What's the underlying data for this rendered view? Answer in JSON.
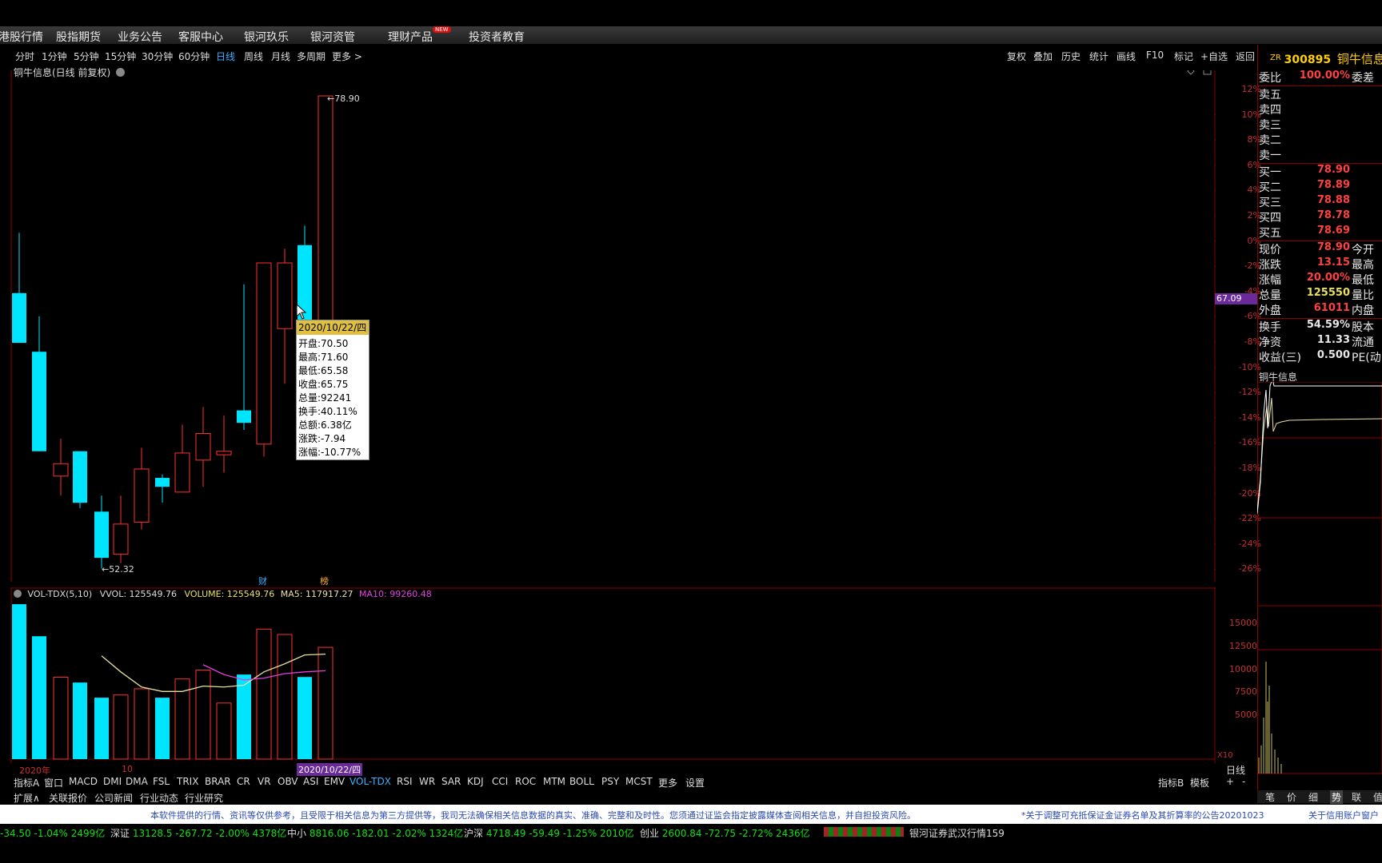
{
  "menu": [
    "港股行情",
    "股指期货",
    "业务公告",
    "客服中心",
    "银河玖乐",
    "银河资管",
    "理财产品",
    "投资者教育"
  ],
  "menu_badge": "NEW",
  "periods": [
    "分时",
    "1分钟",
    "5分钟",
    "15分钟",
    "30分钟",
    "60分钟",
    "日线",
    "周线",
    "月线",
    "多周期",
    "更多 >"
  ],
  "active_period": "日线",
  "tools": [
    "复权",
    "叠加",
    "历史",
    "统计",
    "画线",
    "F10",
    "标记",
    "+自选",
    "返回"
  ],
  "stock": {
    "prefix": "ZR",
    "code": "300895",
    "name": "铜牛信息"
  },
  "chart_title": "铜牛信息(日线 前复权)",
  "high_label": "78.90",
  "low_label": "52.32",
  "price_axis_label": "67.09",
  "markers": [
    "财",
    "榜"
  ],
  "tooltip": {
    "date": "2020/10/22/四",
    "rows": [
      "开盘:70.50",
      "最高:71.60",
      "最低:65.58",
      "收盘:65.75",
      "总量:92241",
      "换手:40.11%",
      "总额:6.38亿",
      "涨跌:-7.94",
      "涨幅:-10.77%"
    ]
  },
  "pct_ticks": [
    "12%",
    "10%",
    "8%",
    "6%",
    "4%",
    "2%",
    "0%",
    "-2%",
    "-4%",
    "-6%",
    "-8%",
    "-10%",
    "-12%",
    "-14%",
    "-16%",
    "-18%",
    "-20%",
    "-22%",
    "-24%",
    "-26%"
  ],
  "volume_header": {
    "name": "VOL-TDX(5,10)",
    "vvol": "VVOL: 125549.76",
    "volume": "VOLUME: 125549.76",
    "ma5": "MA5: 117917.27",
    "ma10": "MA10: 99260.48"
  },
  "volume_ticks": [
    "15000",
    "12500",
    "10000",
    "7500",
    "5000"
  ],
  "volume_unit": "X10",
  "axis_labels": {
    "year": "2020年",
    "month": "10",
    "date": "2020/10/22/四",
    "period": "日线"
  },
  "indicators": [
    "指标A",
    "窗口",
    "MACD",
    "DMI",
    "DMA",
    "FSL",
    "TRIX",
    "BRAR",
    "CR",
    "VR",
    "OBV",
    "ASI",
    "EMV",
    "VOL-TDX",
    "RSI",
    "WR",
    "SAR",
    "KDJ",
    "CCI",
    "ROC",
    "MTM",
    "BOLL",
    "PSY",
    "MCST",
    "更多",
    "设置"
  ],
  "active_indicator": "VOL-TDX",
  "right_tools": [
    "指标B",
    "模板",
    "+",
    "-"
  ],
  "bottom_tabs": [
    "扩展∧",
    "关联报价",
    "公司新闻",
    "行业动态",
    "行业研究"
  ],
  "quote": {
    "ratio_label": "委比",
    "ratio_value": "100.00%",
    "diff_label": "委差",
    "sell": [
      "卖五",
      "卖四",
      "卖三",
      "卖二",
      "卖一"
    ],
    "buy": [
      {
        "label": "买一",
        "value": "78.90"
      },
      {
        "label": "买二",
        "value": "78.89"
      },
      {
        "label": "买三",
        "value": "78.88"
      },
      {
        "label": "买四",
        "value": "78.78"
      },
      {
        "label": "买五",
        "value": "78.69"
      }
    ],
    "stats": [
      {
        "label": "现价",
        "value": "78.90",
        "label2": "今开"
      },
      {
        "label": "涨跌",
        "value": "13.15",
        "label2": "最高"
      },
      {
        "label": "涨幅",
        "value": "20.00%",
        "label2": "最低"
      },
      {
        "label": "总量",
        "value": "125550",
        "label2": "量比"
      },
      {
        "label": "外盘",
        "value": "61011",
        "label2": "内盘"
      },
      {
        "label": "换手",
        "value": "54.59%",
        "label2": "股本"
      },
      {
        "label": "净资",
        "value": "11.33",
        "label2": "流通"
      },
      {
        "label": "收益(三)",
        "value": "0.500",
        "label2": "PE(动"
      }
    ],
    "mini_title": "铜牛信息",
    "mini_tabs": [
      "笔",
      "价",
      "细",
      "势",
      "联",
      "值"
    ]
  },
  "disclaimer": "本软件提供的行情、资讯等仅供参考，且受限于相关信息为第三方提供等，我司无法确保相关信息数据的真实、准确、完整和及时性。您须通过证监会指定披露媒体查阅相关信息，并自担投资风险。",
  "notice1": "*关于调整可充抵保证金证券名单及其折算率的公告20201023",
  "notice2": "关于信用账户窗户",
  "ticker": [
    {
      "name": "",
      "text": "-34.50  -1.04%  2499亿"
    },
    {
      "name": "深证",
      "text": "13128.5  -267.72  -2.00%  4378亿"
    },
    {
      "name": "中小",
      "text": "8816.06  -182.01  -2.02%  1324亿"
    },
    {
      "name": "沪深",
      "text": "4718.49  -59.49  -1.25%  2010亿"
    },
    {
      "name": "创业",
      "text": "2600.84  -72.75  -2.72%  2436亿"
    }
  ],
  "status": "银河证券武汉行情159",
  "colors": {
    "up": "#ff3030",
    "down": "#00e5ff",
    "grid": "#8b0000",
    "ma5": "#e8e0a0",
    "ma10": "#e040e0"
  },
  "chart_data": [
    {
      "type": "candlestick",
      "title": "铜牛信息(日线 前复权)",
      "candles": [
        {
          "o": 67.8,
          "c": 65.0,
          "h": 71.2,
          "l": 65.0
        },
        {
          "o": 64.5,
          "c": 58.9,
          "h": 66.5,
          "l": 58.9
        },
        {
          "o": 57.5,
          "c": 58.2,
          "h": 59.6,
          "l": 56.4
        },
        {
          "o": 58.9,
          "c": 56.0,
          "h": 58.9,
          "l": 55.7
        },
        {
          "o": 55.5,
          "c": 52.9,
          "h": 56.4,
          "l": 52.3
        },
        {
          "o": 53.1,
          "c": 54.8,
          "h": 56.4,
          "l": 52.6
        },
        {
          "o": 54.9,
          "c": 57.9,
          "h": 59.1,
          "l": 54.5
        },
        {
          "o": 57.4,
          "c": 56.9,
          "h": 57.6,
          "l": 56.0
        },
        {
          "o": 56.6,
          "c": 58.8,
          "h": 60.4,
          "l": 56.6
        },
        {
          "o": 58.4,
          "c": 59.9,
          "h": 61.4,
          "l": 56.9
        },
        {
          "o": 58.7,
          "c": 58.9,
          "h": 60.9,
          "l": 57.7
        },
        {
          "o": 61.2,
          "c": 60.5,
          "h": 68.3,
          "l": 60.1
        },
        {
          "o": 59.3,
          "c": 69.5,
          "h": 69.5,
          "l": 58.6
        },
        {
          "o": 65.8,
          "c": 69.5,
          "h": 70.3,
          "l": 62.7
        },
        {
          "o": 70.5,
          "c": 65.75,
          "h": 71.6,
          "l": 65.58
        },
        {
          "o": 65.75,
          "c": 78.9,
          "h": 78.9,
          "l": 65.75
        }
      ],
      "ylim": [
        50,
        80
      ]
    },
    {
      "type": "bar",
      "title": "VOL-TDX(5,10)",
      "values": [
        174000,
        138000,
        92000,
        86000,
        69000,
        72000,
        79000,
        69000,
        90000,
        100000,
        63000,
        95000,
        146000,
        140000,
        92241,
        125550
      ],
      "directions": [
        "down",
        "down",
        "up",
        "down",
        "down",
        "up",
        "up",
        "down",
        "up",
        "up",
        "up",
        "down",
        "up",
        "up",
        "down",
        "up"
      ],
      "ma5": [
        null,
        null,
        null,
        null,
        116000,
        98000,
        81000,
        76000,
        76000,
        82000,
        81000,
        83000,
        98000,
        107000,
        117000,
        117917
      ],
      "ma10": [
        null,
        null,
        null,
        null,
        null,
        null,
        null,
        null,
        null,
        106000,
        95000,
        89000,
        91000,
        96000,
        98000,
        99260
      ],
      "ylim": [
        0,
        175000
      ]
    }
  ]
}
